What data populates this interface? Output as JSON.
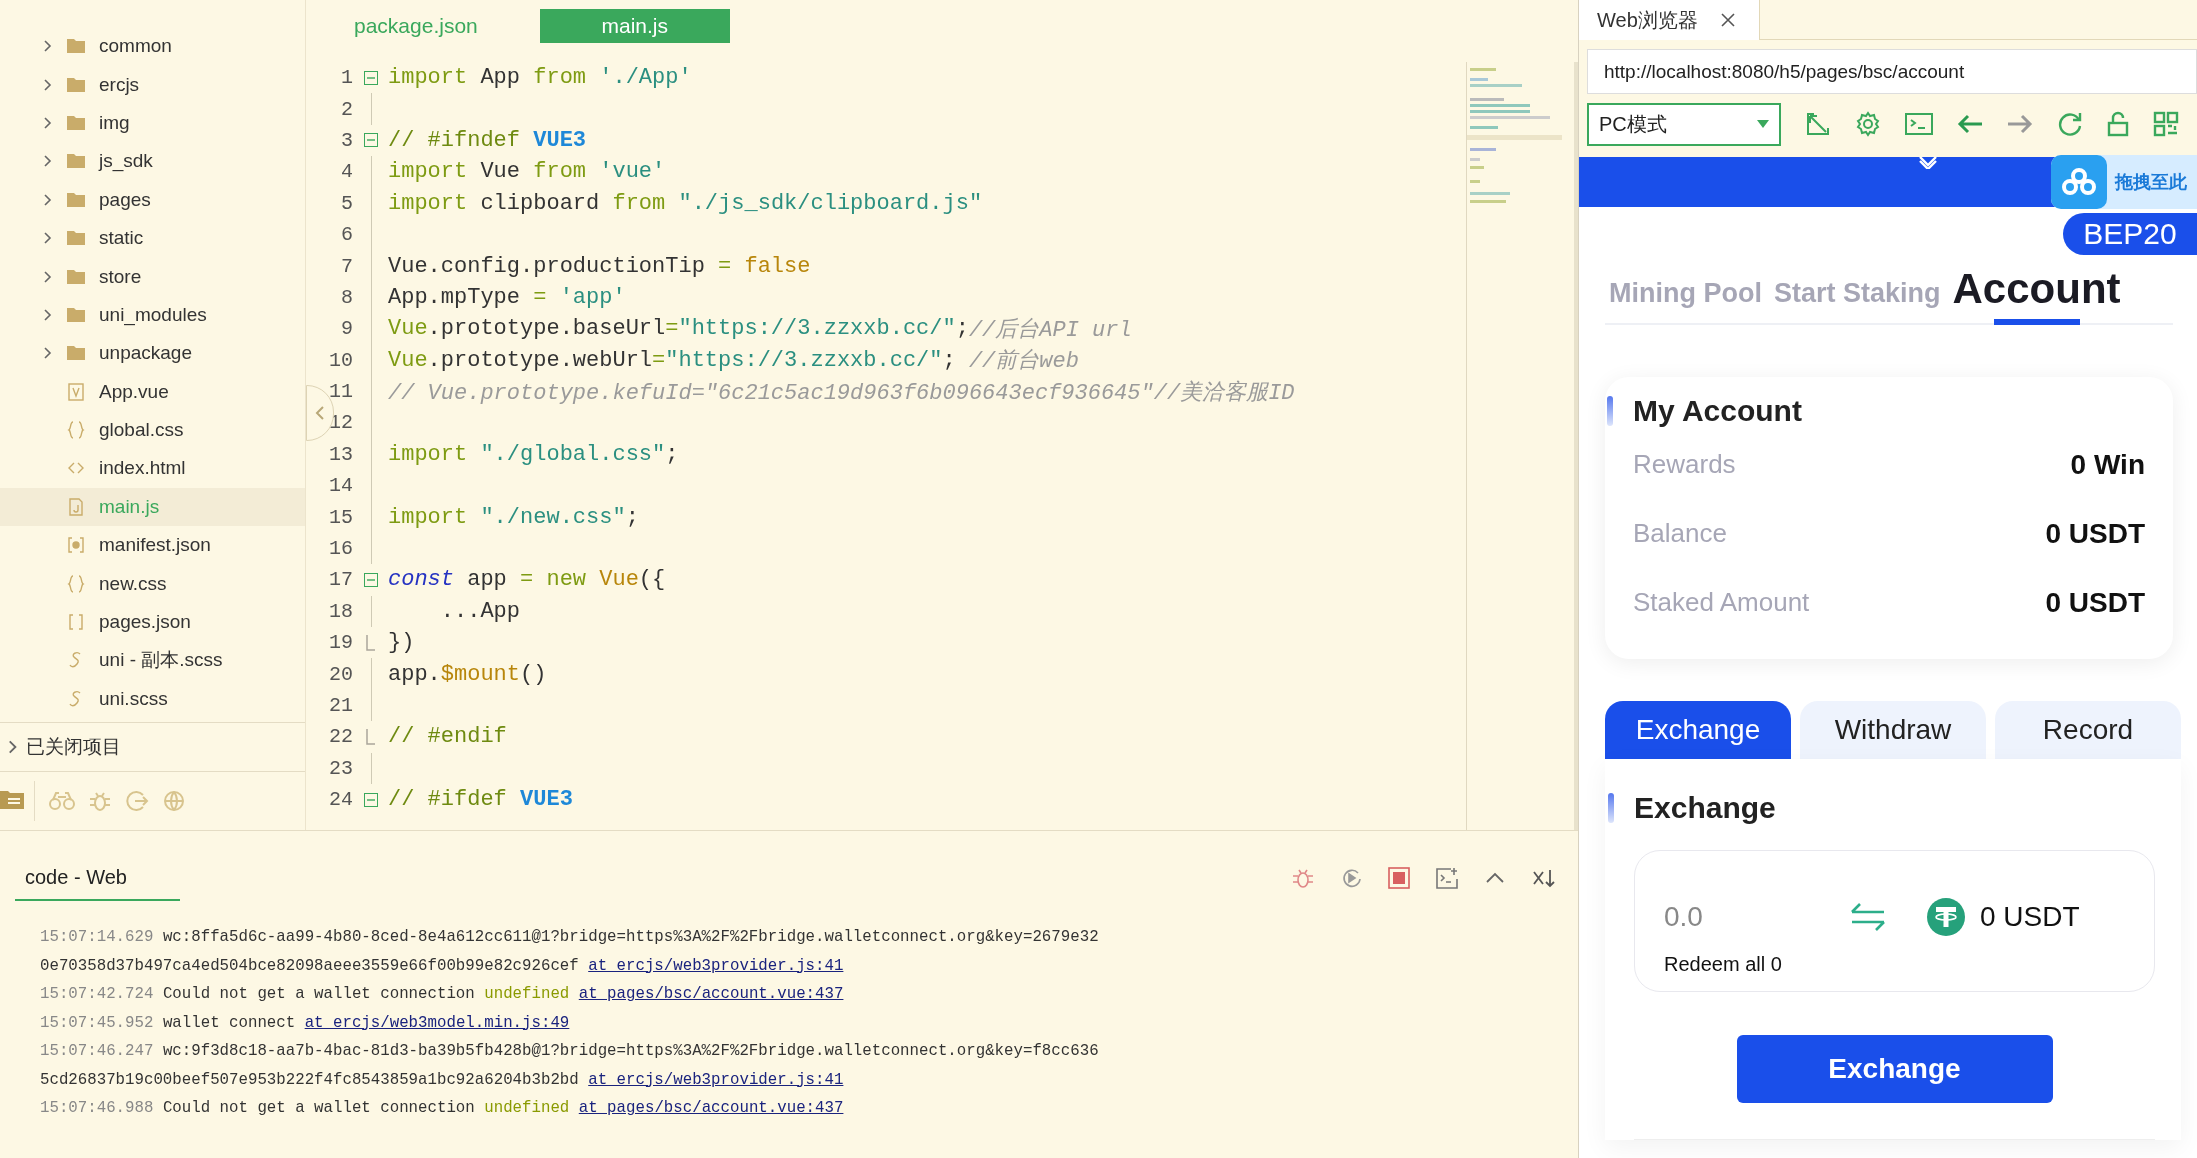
{
  "sidebar": {
    "tree": [
      {
        "name": "common",
        "kind": "folder",
        "expanded": false,
        "selected": false
      },
      {
        "name": "ercjs",
        "kind": "folder",
        "expanded": false,
        "selected": false
      },
      {
        "name": "img",
        "kind": "folder",
        "expanded": false,
        "selected": false
      },
      {
        "name": "js_sdk",
        "kind": "folder",
        "expanded": false,
        "selected": false
      },
      {
        "name": "pages",
        "kind": "folder",
        "expanded": false,
        "selected": false
      },
      {
        "name": "static",
        "kind": "folder",
        "expanded": false,
        "selected": false
      },
      {
        "name": "store",
        "kind": "folder",
        "expanded": false,
        "selected": false
      },
      {
        "name": "uni_modules",
        "kind": "folder",
        "expanded": false,
        "selected": false
      },
      {
        "name": "unpackage",
        "kind": "folder",
        "expanded": false,
        "selected": false
      },
      {
        "name": "App.vue",
        "kind": "vue",
        "selected": false
      },
      {
        "name": "global.css",
        "kind": "css",
        "selected": false
      },
      {
        "name": "index.html",
        "kind": "html",
        "selected": false
      },
      {
        "name": "main.js",
        "kind": "js",
        "selected": true
      },
      {
        "name": "manifest.json",
        "kind": "manifest",
        "selected": false
      },
      {
        "name": "new.css",
        "kind": "css",
        "selected": false
      },
      {
        "name": "pages.json",
        "kind": "json",
        "selected": false
      },
      {
        "name": "uni - 副本.scss",
        "kind": "scss",
        "selected": false
      },
      {
        "name": "uni.scss",
        "kind": "scss",
        "selected": false
      }
    ],
    "closed_projects": {
      "label": "已关闭项目",
      "expanded": false
    }
  },
  "editor": {
    "tabs": [
      {
        "label": "package.json",
        "selected": false
      },
      {
        "label": "main.js",
        "selected": true
      }
    ],
    "lines": [
      {
        "number": "1",
        "kind": "fold-start",
        "tokens": [
          {
            "text": "import",
            "kind": "kw"
          },
          {
            "text": " App ",
            "kind": "plain"
          },
          {
            "text": "from",
            "kind": "kw"
          },
          {
            "text": " './App'",
            "kind": "str"
          }
        ]
      },
      {
        "number": "2",
        "kind": "plain"
      },
      {
        "number": "3",
        "kind": "fold-start",
        "tokens": [
          {
            "text": "// #ifndef ",
            "kind": "directive"
          },
          {
            "text": "VUE3",
            "kind": "macro"
          }
        ]
      },
      {
        "number": "4",
        "kind": "plain",
        "tokens": [
          {
            "text": "import",
            "kind": "kw"
          },
          {
            "text": " Vue ",
            "kind": "plain"
          },
          {
            "text": "from",
            "kind": "kw"
          },
          {
            "text": " 'vue'",
            "kind": "str"
          }
        ]
      },
      {
        "number": "5",
        "kind": "plain",
        "tokens": [
          {
            "text": "import",
            "kind": "kw"
          },
          {
            "text": " clipboard ",
            "kind": "plain"
          },
          {
            "text": "from",
            "kind": "kw"
          },
          {
            "text": " \"./js_sdk/clipboard.js\"",
            "kind": "str"
          }
        ]
      },
      {
        "number": "6",
        "kind": "plain"
      },
      {
        "number": "7",
        "kind": "plain",
        "tokens": [
          {
            "text": "Vue.config.productionTip ",
            "kind": "plain"
          },
          {
            "text": "= ",
            "kind": "kw"
          },
          {
            "text": "false",
            "kind": "const"
          }
        ]
      },
      {
        "number": "8",
        "kind": "plain",
        "tokens": [
          {
            "text": "App.mpType ",
            "kind": "plain"
          },
          {
            "text": "= ",
            "kind": "kw"
          },
          {
            "text": "'app'",
            "kind": "str"
          }
        ]
      },
      {
        "number": "9",
        "kind": "plain",
        "tokens": [
          {
            "text": "Vue",
            "kind": "kw"
          },
          {
            "text": ".prototype.baseUrl",
            "kind": "plain"
          },
          {
            "text": "=",
            "kind": "kw"
          },
          {
            "text": "\"https://3.zzxxb.cc/\"",
            "kind": "str"
          },
          {
            "text": ";",
            "kind": "plain"
          },
          {
            "text": "//后台API url",
            "kind": "comment"
          }
        ]
      },
      {
        "number": "10",
        "kind": "plain",
        "tokens": [
          {
            "text": "Vue",
            "kind": "kw"
          },
          {
            "text": ".prototype.webUrl",
            "kind": "plain"
          },
          {
            "text": "=",
            "kind": "kw"
          },
          {
            "text": "\"https://3.zzxxb.cc/\"",
            "kind": "str"
          },
          {
            "text": ";",
            "kind": "plain"
          },
          {
            "text": " //前台web",
            "kind": "comment"
          }
        ]
      },
      {
        "number": "11",
        "kind": "plain",
        "tokens": [
          {
            "text": "// Vue.prototype.kefuId=\"6c21c5ac19d963f6b096643ecf936645\"//美洽客服ID",
            "kind": "comment"
          }
        ]
      },
      {
        "number": "12",
        "kind": "plain"
      },
      {
        "number": "13",
        "kind": "plain",
        "tokens": [
          {
            "text": "import ",
            "kind": "kw"
          },
          {
            "text": "\"./global.css\"",
            "kind": "str"
          },
          {
            "text": ";",
            "kind": "plain"
          }
        ]
      },
      {
        "number": "14",
        "kind": "plain"
      },
      {
        "number": "15",
        "kind": "plain",
        "tokens": [
          {
            "text": "import ",
            "kind": "kw"
          },
          {
            "text": "\"./new.css\"",
            "kind": "str"
          },
          {
            "text": ";",
            "kind": "plain"
          }
        ]
      },
      {
        "number": "16",
        "kind": "plain"
      },
      {
        "number": "17",
        "kind": "fold-start",
        "tokens": [
          {
            "text": "const",
            "kind": "storage"
          },
          {
            "text": " app ",
            "kind": "plain"
          },
          {
            "text": "= new ",
            "kind": "kw"
          },
          {
            "text": "Vue",
            "kind": "const"
          },
          {
            "text": "({",
            "kind": "plain"
          }
        ]
      },
      {
        "number": "18",
        "kind": "plain",
        "tokens": [
          {
            "text": "    ...App",
            "kind": "plain"
          }
        ]
      },
      {
        "number": "19",
        "kind": "fold-end",
        "tokens": [
          {
            "text": "})",
            "kind": "plain"
          }
        ]
      },
      {
        "number": "20",
        "kind": "plain",
        "tokens": [
          {
            "text": "app.",
            "kind": "plain"
          },
          {
            "text": "$mount",
            "kind": "const"
          },
          {
            "text": "()",
            "kind": "plain"
          }
        ]
      },
      {
        "number": "21",
        "kind": "plain"
      },
      {
        "number": "22",
        "kind": "fold-end",
        "tokens": [
          {
            "text": "// #endif",
            "kind": "directive"
          }
        ]
      },
      {
        "number": "23",
        "kind": "plain"
      },
      {
        "number": "24",
        "kind": "fold-start",
        "tokens": [
          {
            "text": "// #ifdef ",
            "kind": "directive"
          },
          {
            "text": "VUE3",
            "kind": "macro"
          }
        ]
      }
    ]
  },
  "console": {
    "tab": "code - Web",
    "entries": [
      {
        "time": "15:07:14.629",
        "parts": [
          {
            "text": "wc:8ffa5d6c-aa99-4b80-8ced-8e4a612cc611@1?bridge=https%3A%2F%2Fbridge.walletconnect.org&key=2679e320e70358d37b497ca4ed504bce82098aeee3559e66f00b99e82c926cef",
            "kind": "text"
          },
          {
            "text": "at ercjs/web3provider.js:41",
            "kind": "link"
          }
        ]
      },
      {
        "time": "15:07:42.724",
        "parts": [
          {
            "text": "Could not get a wallet connection",
            "kind": "text"
          },
          {
            "text": "undefined",
            "kind": "value"
          },
          {
            "text": "at pages/bsc/account.vue:437",
            "kind": "link"
          }
        ]
      },
      {
        "time": "15:07:45.952",
        "parts": [
          {
            "text": "wallet connect",
            "kind": "text"
          },
          {
            "text": "at ercjs/web3model.min.js:49",
            "kind": "link"
          }
        ]
      },
      {
        "time": "15:07:46.247",
        "parts": [
          {
            "text": "wc:9f3d8c18-aa7b-4bac-81d3-ba39b5fb428b@1?bridge=https%3A%2F%2Fbridge.walletconnect.org&key=f8cc6365cd26837b19c00beef507e953b222f4fc8543859a1bc92a6204b3b2bd",
            "kind": "text"
          },
          {
            "text": "at ercjs/web3provider.js:41",
            "kind": "link"
          }
        ]
      },
      {
        "time": "15:07:46.988",
        "parts": [
          {
            "text": "Could not get a wallet connection",
            "kind": "text"
          },
          {
            "text": "undefined",
            "kind": "value"
          },
          {
            "text": "at pages/bsc/account.vue:437",
            "kind": "link"
          }
        ]
      }
    ]
  },
  "browser": {
    "tab": "Web浏览器",
    "url": "http://localhost:8080/h5/pages/bsc/account",
    "mode": "PC模式",
    "page": {
      "drop_label": "拖拽至此",
      "network": "BEP20",
      "nav": [
        {
          "label": "Mining Pool",
          "selected": false
        },
        {
          "label": "Start Staking",
          "selected": false
        },
        {
          "label": "Account",
          "selected": true
        }
      ],
      "account": {
        "title": "My Account",
        "rows": [
          {
            "label": "Rewards",
            "value": "0 Win"
          },
          {
            "label": "Balance",
            "value": "0 USDT"
          },
          {
            "label": "Staked Amount",
            "value": "0 USDT"
          }
        ]
      },
      "tabs": [
        {
          "label": "Exchange",
          "selected": true
        },
        {
          "label": "Withdraw",
          "selected": false
        },
        {
          "label": "Record",
          "selected": false
        }
      ],
      "exchange": {
        "title": "Exchange",
        "placeholder": "0.0",
        "balance": "0 USDT",
        "redeem": "Redeem all 0",
        "button": "Exchange"
      }
    }
  }
}
